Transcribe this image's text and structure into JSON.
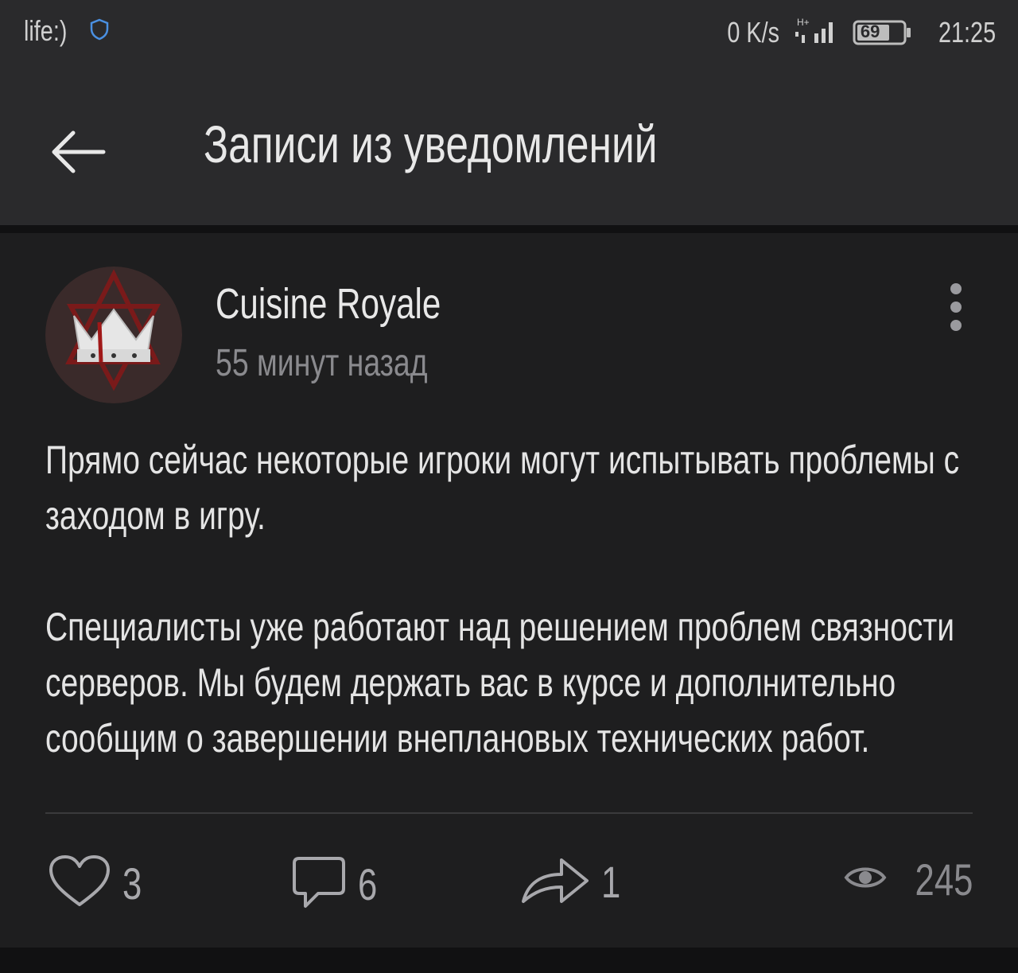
{
  "status_bar": {
    "carrier": "life:)",
    "network_speed": "0 K/s",
    "signal_label": "H+",
    "battery": "69",
    "time": "21:25"
  },
  "header": {
    "title": "Записи из уведомлений",
    "back_icon": "arrow-left-icon"
  },
  "post": {
    "author": "Cuisine Royale",
    "time_ago": "55 минут назад",
    "paragraphs": [
      "Прямо сейчас некоторые игроки могут испытывать проблемы с заходом в игру.",
      "Специалисты уже работают над решением проблем связности серверов. Мы будем держать вас в курсе и дополнительно сообщим о завершении внеплановых технических работ."
    ],
    "likes": "3",
    "comments": "6",
    "shares": "1",
    "views": "245"
  },
  "colors": {
    "background": "#111112",
    "bar": "#2a2a2c",
    "card": "#1e1e1f",
    "text": "#e4e4e4",
    "muted": "#8a8a8e"
  }
}
